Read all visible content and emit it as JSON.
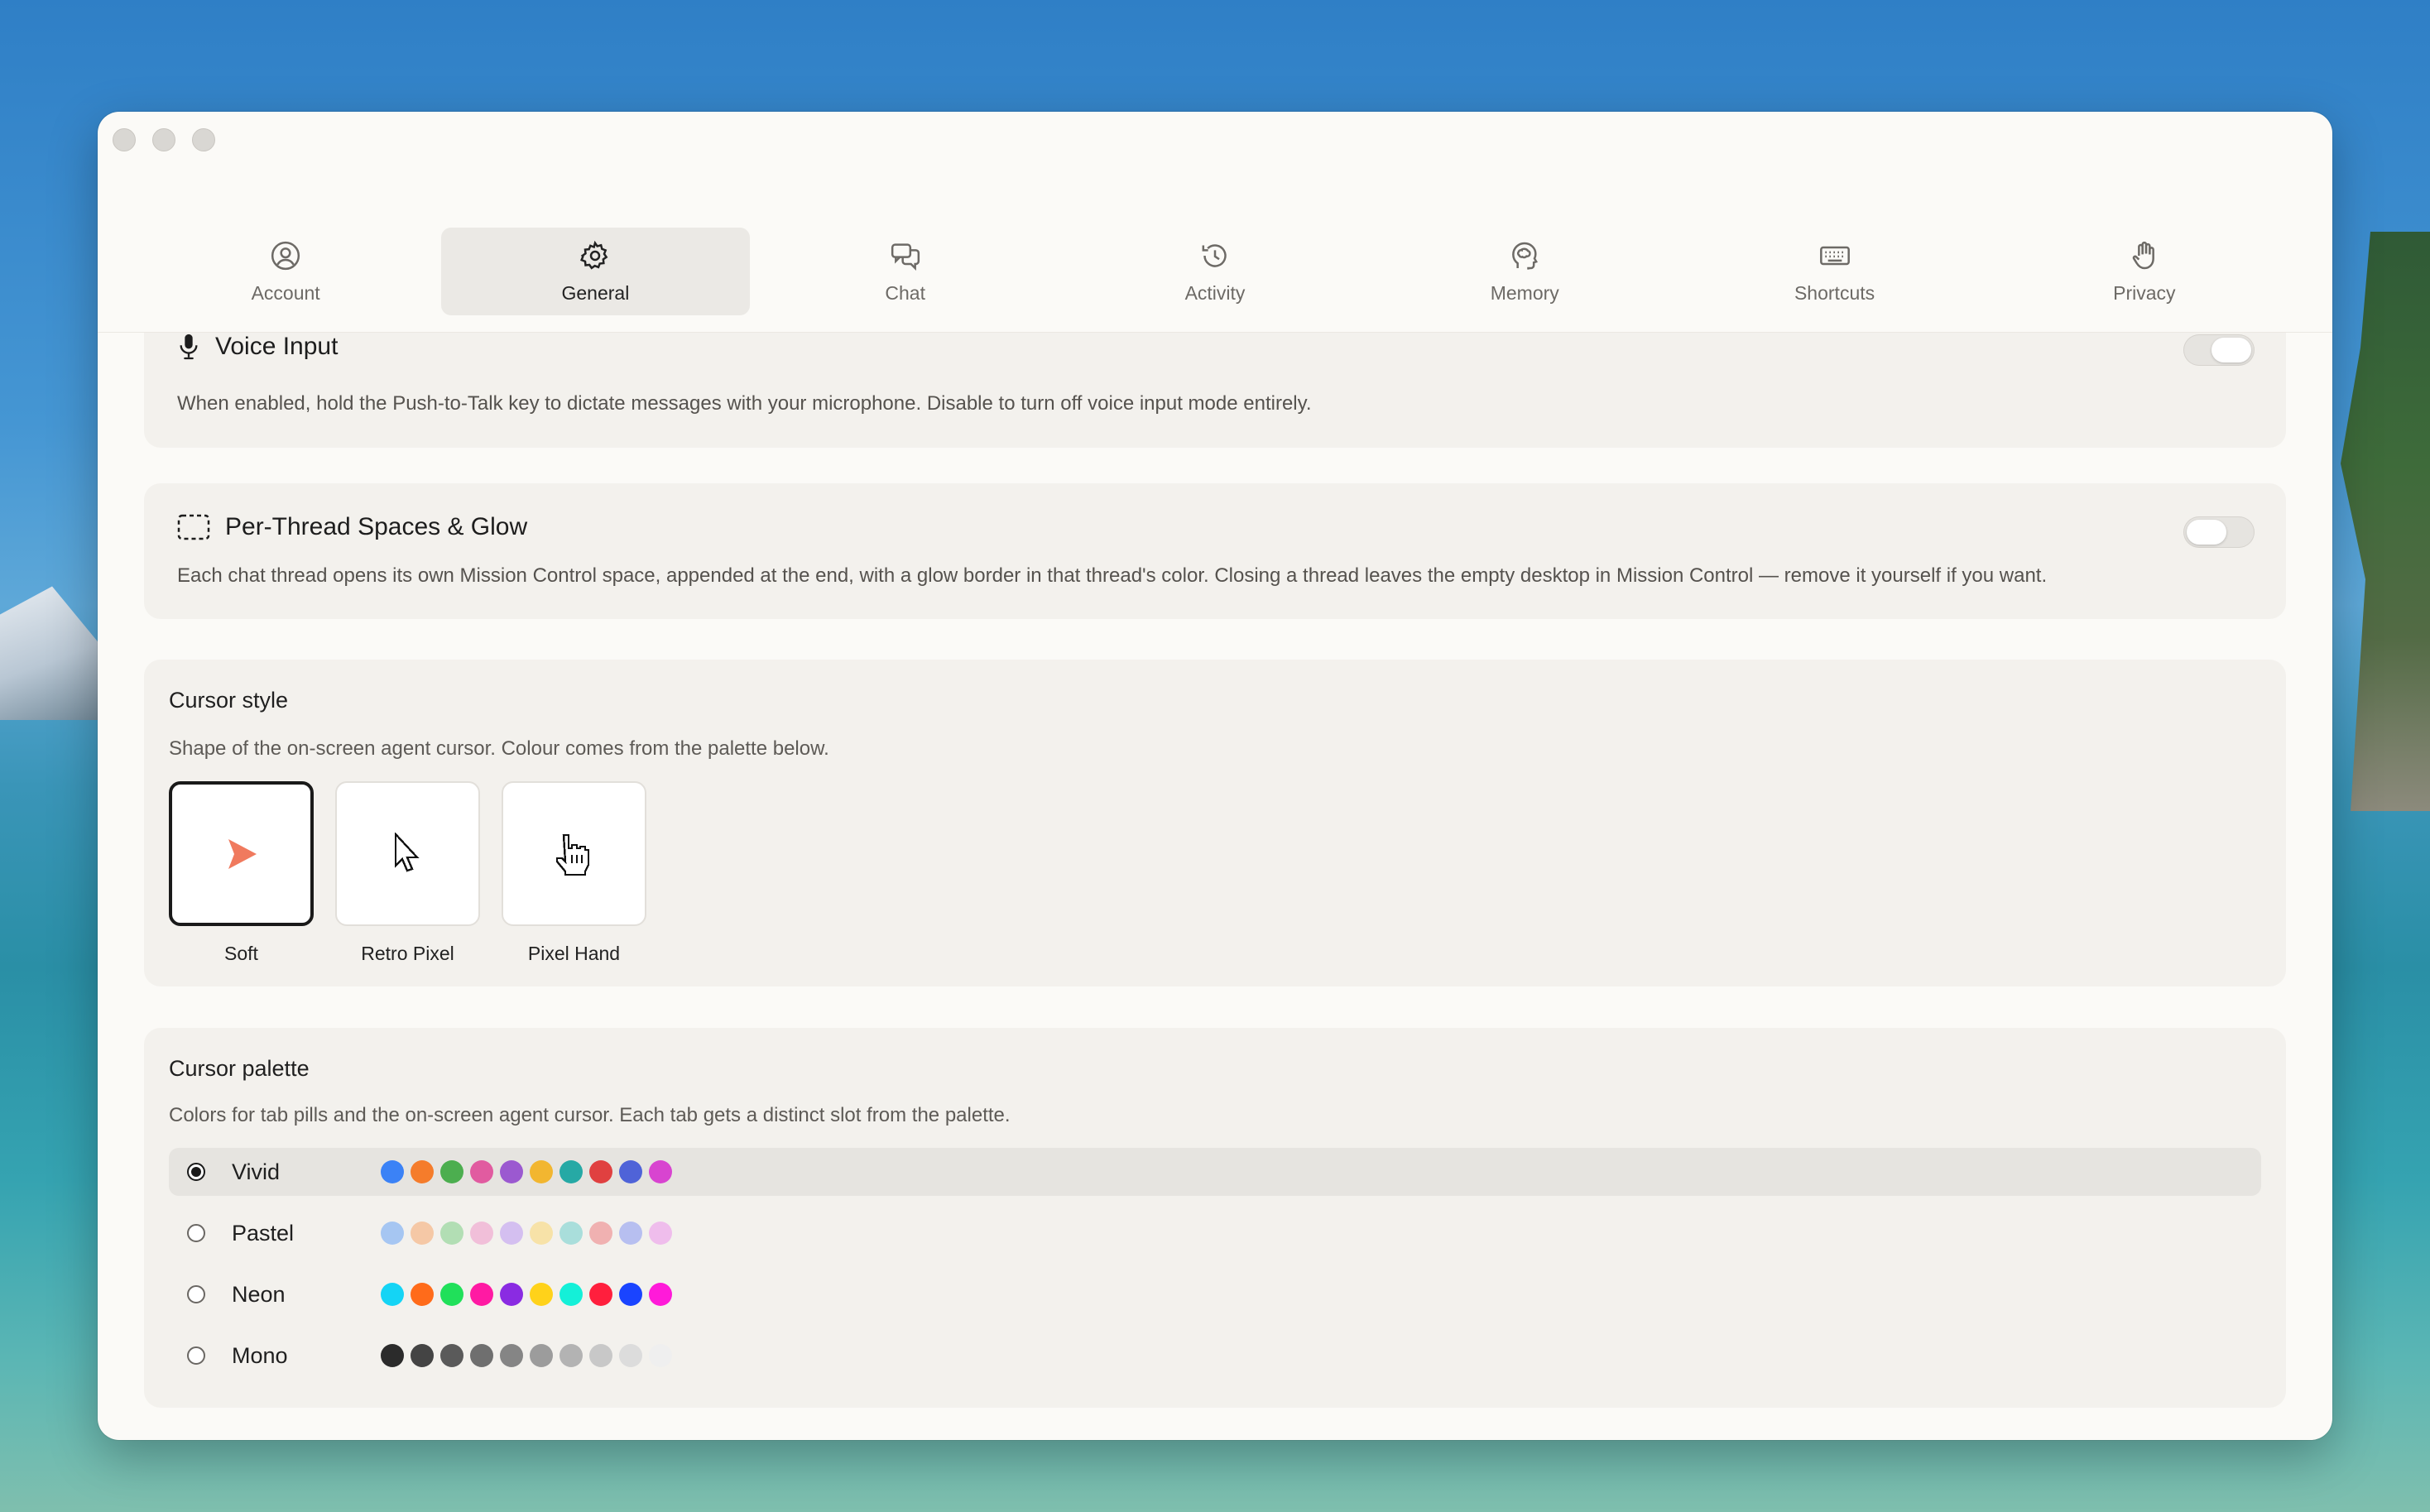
{
  "window": {
    "tabs": [
      {
        "label": "Account",
        "icon": "account-icon",
        "active": false
      },
      {
        "label": "General",
        "icon": "gear-icon",
        "active": true
      },
      {
        "label": "Chat",
        "icon": "chat-bubbles-icon",
        "active": false
      },
      {
        "label": "Activity",
        "icon": "history-icon",
        "active": false
      },
      {
        "label": "Memory",
        "icon": "brain-head-icon",
        "active": false
      },
      {
        "label": "Shortcuts",
        "icon": "keyboard-icon",
        "active": false
      },
      {
        "label": "Privacy",
        "icon": "hand-icon",
        "active": false
      }
    ]
  },
  "settings": {
    "voice_input": {
      "title": "Voice Input",
      "description": "When enabled, hold the Push-to-Talk key to dictate messages with your microphone. Disable to turn off voice input mode entirely."
    },
    "spaces_glow": {
      "title": "Per-Thread Spaces & Glow",
      "description": "Each chat thread opens its own Mission Control space, appended at the end, with a glow border in that thread's color. Closing a thread leaves the empty desktop in Mission Control — remove it yourself if you want."
    },
    "cursor_style": {
      "title": "Cursor style",
      "description": "Shape of the on-screen agent cursor. Colour comes from the palette below.",
      "options": [
        {
          "label": "Soft",
          "icon": "soft-cursor-icon",
          "selected": true
        },
        {
          "label": "Retro Pixel",
          "icon": "retro-pixel-cursor-icon",
          "selected": false
        },
        {
          "label": "Pixel Hand",
          "icon": "pixel-hand-cursor-icon",
          "selected": false
        }
      ]
    },
    "cursor_palette": {
      "title": "Cursor palette",
      "description": "Colors for tab pills and the on-screen agent cursor. Each tab gets a distinct slot from the palette.",
      "options": [
        {
          "label": "Vivid",
          "selected": true,
          "colors": [
            "#3b82f6",
            "#f57c2b",
            "#4cae4f",
            "#e15ba0",
            "#9b59d0",
            "#f2b630",
            "#26a9a5",
            "#e04040",
            "#4f63d8",
            "#d844d0"
          ]
        },
        {
          "label": "Pastel",
          "selected": false,
          "colors": [
            "#a6c6f2",
            "#f5c8a6",
            "#b2deb4",
            "#f1bfd9",
            "#d4bff0",
            "#f7e2a8",
            "#a9dedb",
            "#f0b1b1",
            "#b7bff0",
            "#efbdec"
          ]
        },
        {
          "label": "Neon",
          "selected": false,
          "colors": [
            "#14d4f5",
            "#ff6b1a",
            "#20e05a",
            "#ff1aa3",
            "#8a2be2",
            "#ffd21a",
            "#14f0d8",
            "#ff1f3d",
            "#1a44ff",
            "#ff1ad9"
          ]
        },
        {
          "label": "Mono",
          "selected": false,
          "colors": [
            "#2b2b2b",
            "#444444",
            "#5a5a5a",
            "#6f6f6f",
            "#858585",
            "#9c9c9c",
            "#b3b3b3",
            "#c8c8c8",
            "#dcdcdc",
            "#efefef"
          ]
        }
      ]
    }
  }
}
